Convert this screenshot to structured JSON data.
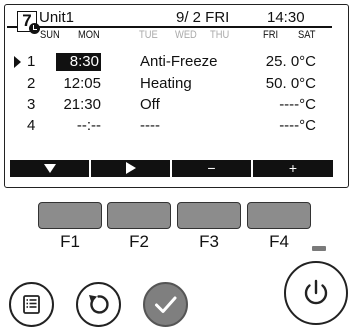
{
  "header": {
    "program_number": "7",
    "unit_name": "Unit1",
    "date": "9/ 2 FRI",
    "time": "14:30"
  },
  "weekdays": [
    {
      "label": "SUN",
      "active": true
    },
    {
      "label": "MON",
      "active": true
    },
    {
      "label": "TUE",
      "active": false
    },
    {
      "label": "WED",
      "active": false
    },
    {
      "label": "THU",
      "active": false
    },
    {
      "label": "FRI",
      "active": true
    },
    {
      "label": "SAT",
      "active": true
    }
  ],
  "schedule": [
    {
      "no": "1",
      "time": "8:30",
      "mode": "Anti-Freeze",
      "temp": "25. 0°C",
      "selected": true
    },
    {
      "no": "2",
      "time": "12:05",
      "mode": "Heating",
      "temp": "50. 0°C",
      "selected": false
    },
    {
      "no": "3",
      "time": "21:30",
      "mode": "Off",
      "temp": "----°C",
      "selected": false
    },
    {
      "no": "4",
      "time": "--:--",
      "mode": "----",
      "temp": "----°C",
      "selected": false
    }
  ],
  "softkeys": {
    "f1": "down-arrow",
    "f2": "right-arrow",
    "f3": "−",
    "f4": "+"
  },
  "function_keys": [
    "F1",
    "F2",
    "F3",
    "F4"
  ],
  "buttons": {
    "menu": "menu-icon",
    "back": "return-icon",
    "confirm": "check-icon",
    "power": "power-icon"
  },
  "colors": {
    "key_gray": "#8c8c8c",
    "confirm_gray": "#7f7f7f",
    "disabled_day": "#aaaaaa"
  }
}
